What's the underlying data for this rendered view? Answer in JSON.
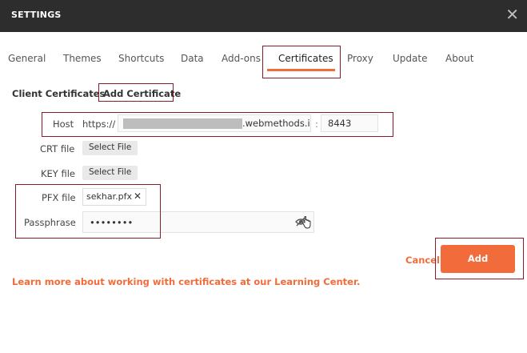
{
  "window": {
    "title": "SETTINGS",
    "close_glyph": "✕"
  },
  "tabs": [
    {
      "label": "General"
    },
    {
      "label": "Themes"
    },
    {
      "label": "Shortcuts"
    },
    {
      "label": "Data"
    },
    {
      "label": "Add-ons"
    },
    {
      "label": "Certificates",
      "active": true
    },
    {
      "label": "Proxy"
    },
    {
      "label": "Update"
    },
    {
      "label": "About"
    }
  ],
  "section": {
    "title": "Client Certificates",
    "add_link": "Add Certificate"
  },
  "form": {
    "host": {
      "label": "Host",
      "prefix": "https://",
      "value_suffix": ".webmethods.io",
      "port": "8443"
    },
    "crt": {
      "label": "CRT file",
      "button": "Select File"
    },
    "key": {
      "label": "KEY file",
      "button": "Select File"
    },
    "pfx": {
      "label": "PFX file",
      "file_name": "sekhar.pfx",
      "remove_glyph": "✕"
    },
    "passphrase": {
      "label": "Passphrase",
      "value": "••••••••"
    }
  },
  "actions": {
    "cancel": "Cancel",
    "add": "Add"
  },
  "footer": {
    "learn_more": "Learn more about working with certificates at our Learning Center."
  },
  "colors": {
    "accent": "#f26b3a",
    "titlebar": "#2d2d2d",
    "highlight_border": "#8b1a2b"
  },
  "icons": {
    "close": "close-icon",
    "remove": "close-icon",
    "visibility": "eye-slash-icon",
    "cursor": "hand-pointer-icon"
  }
}
